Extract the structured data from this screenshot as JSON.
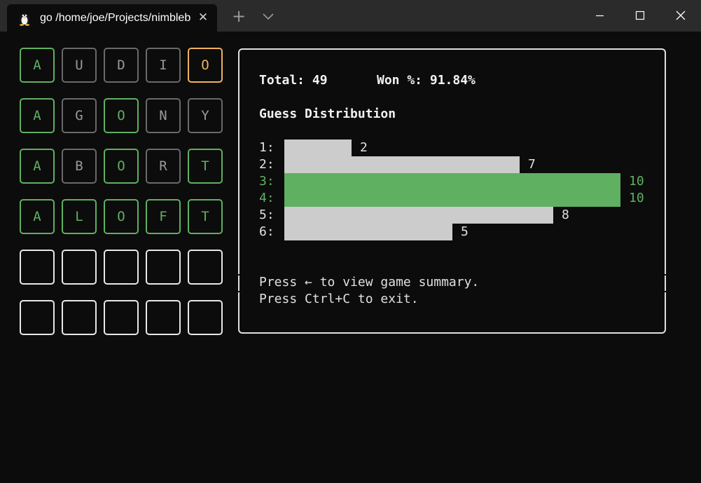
{
  "window": {
    "tab_title": "go /home/joe/Projects/nimbleb",
    "tab_icon": "linux-penguin-icon",
    "new_tab_label": "+",
    "close_tab_label": "✕"
  },
  "board": {
    "rows": [
      [
        {
          "letter": "A",
          "state": "green"
        },
        {
          "letter": "U",
          "state": "gray"
        },
        {
          "letter": "D",
          "state": "gray"
        },
        {
          "letter": "I",
          "state": "gray"
        },
        {
          "letter": "O",
          "state": "orange"
        }
      ],
      [
        {
          "letter": "A",
          "state": "green"
        },
        {
          "letter": "G",
          "state": "gray"
        },
        {
          "letter": "O",
          "state": "green"
        },
        {
          "letter": "N",
          "state": "gray"
        },
        {
          "letter": "Y",
          "state": "gray"
        }
      ],
      [
        {
          "letter": "A",
          "state": "green"
        },
        {
          "letter": "B",
          "state": "gray"
        },
        {
          "letter": "O",
          "state": "green"
        },
        {
          "letter": "R",
          "state": "gray"
        },
        {
          "letter": "T",
          "state": "green"
        }
      ],
      [
        {
          "letter": "A",
          "state": "green"
        },
        {
          "letter": "L",
          "state": "green"
        },
        {
          "letter": "O",
          "state": "green"
        },
        {
          "letter": "F",
          "state": "green"
        },
        {
          "letter": "T",
          "state": "green"
        }
      ],
      [
        {
          "letter": "",
          "state": "empty"
        },
        {
          "letter": "",
          "state": "empty"
        },
        {
          "letter": "",
          "state": "empty"
        },
        {
          "letter": "",
          "state": "empty"
        },
        {
          "letter": "",
          "state": "empty"
        }
      ],
      [
        {
          "letter": "",
          "state": "empty"
        },
        {
          "letter": "",
          "state": "empty"
        },
        {
          "letter": "",
          "state": "empty"
        },
        {
          "letter": "",
          "state": "empty"
        },
        {
          "letter": "",
          "state": "empty"
        }
      ]
    ]
  },
  "stats": {
    "total_label": "Total: 49",
    "won_label": "Won %: 91.84%",
    "distribution_title": "Guess Distribution",
    "hint_summary": "Press ← to view game summary.",
    "hint_exit": "Press Ctrl+C to exit."
  },
  "chart_data": {
    "type": "bar",
    "title": "Guess Distribution",
    "categories": [
      "1:",
      "2:",
      "3:",
      "4:",
      "5:",
      "6:"
    ],
    "values": [
      2,
      7,
      10,
      10,
      8,
      5
    ],
    "highlighted": [
      false,
      false,
      true,
      true,
      false,
      false
    ]
  },
  "colors": {
    "correct": "#5fb061",
    "present": "#f0b35c",
    "absent": "#6a6a6a",
    "bar": "#cccccc",
    "background": "#0c0c0c"
  }
}
